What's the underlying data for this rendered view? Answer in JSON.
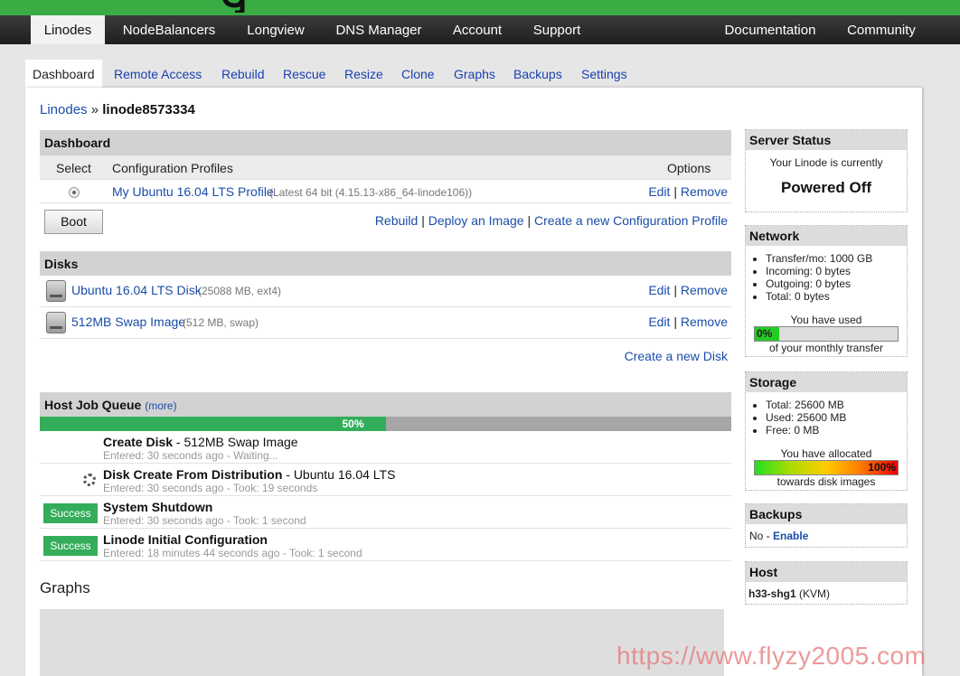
{
  "top_nav": {
    "items": [
      "Linodes",
      "NodeBalancers",
      "Longview",
      "DNS Manager",
      "Account",
      "Support"
    ],
    "right_items": [
      "Documentation",
      "Community"
    ],
    "active": "Linodes"
  },
  "sub_nav": {
    "items": [
      "Dashboard",
      "Remote Access",
      "Rebuild",
      "Rescue",
      "Resize",
      "Clone",
      "Graphs",
      "Backups",
      "Settings"
    ],
    "active": "Dashboard"
  },
  "breadcrumb": {
    "parent": "Linodes",
    "separator": "»",
    "current": "linode8573334"
  },
  "dashboard": {
    "heading": "Dashboard",
    "col_select": "Select",
    "col_profiles": "Configuration Profiles",
    "col_options": "Options",
    "profile": {
      "name": "My Ubuntu 16.04 LTS Profile",
      "detail": "(Latest 64 bit (4.15.13-x86_64-linode106))",
      "edit": "Edit",
      "sep": "|",
      "remove": "Remove"
    },
    "boot_label": "Boot",
    "actions": {
      "rebuild": "Rebuild",
      "deploy": "Deploy an Image",
      "create_profile": "Create a new Configuration Profile",
      "sep": "|"
    }
  },
  "disks": {
    "heading": "Disks",
    "items": [
      {
        "name": "Ubuntu 16.04 LTS Disk",
        "detail": "(25088 MB, ext4)",
        "edit": "Edit",
        "remove": "Remove"
      },
      {
        "name": "512MB Swap Image",
        "detail": "(512 MB, swap)",
        "edit": "Edit",
        "remove": "Remove"
      }
    ],
    "sep": "|",
    "create_label": "Create a new Disk"
  },
  "job_queue": {
    "heading": "Host Job Queue",
    "more": "(more)",
    "progress_percent": 50,
    "progress_label": "50%",
    "jobs": [
      {
        "status": "",
        "title": "Create Disk",
        "detail": " - 512MB Swap Image",
        "sub": "Entered: 30 seconds ago - Waiting..."
      },
      {
        "status": "spinner",
        "title": "Disk Create From Distribution",
        "detail": " - Ubuntu 16.04 LTS",
        "sub": "Entered: 30 seconds ago - Took: 19 seconds"
      },
      {
        "status": "Success",
        "title": "System Shutdown",
        "detail": "",
        "sub": "Entered: 30 seconds ago - Took: 1 second"
      },
      {
        "status": "Success",
        "title": "Linode Initial Configuration",
        "detail": "",
        "sub": "Entered: 18 minutes 44 seconds ago - Took: 1 second"
      }
    ]
  },
  "graphs": {
    "heading": "Graphs"
  },
  "sidebar": {
    "server_status": {
      "heading": "Server Status",
      "line": "Your Linode is currently",
      "state": "Powered Off"
    },
    "network": {
      "heading": "Network",
      "items": [
        "Transfer/mo: 1000 GB",
        "Incoming: 0 bytes",
        "Outgoing: 0 bytes",
        "Total: 0 bytes"
      ],
      "used_label": "You have used",
      "percent": 0,
      "percent_label": "0%",
      "after_label": "of your monthly transfer"
    },
    "storage": {
      "heading": "Storage",
      "items": [
        "Total: 25600 MB",
        "Used: 25600 MB",
        "Free: 0 MB"
      ],
      "allocated_label": "You have allocated",
      "percent": 100,
      "percent_label": "100%",
      "after_label": "towards disk images"
    },
    "backups": {
      "heading": "Backups",
      "status": "No",
      "sep": " - ",
      "enable": "Enable"
    },
    "host": {
      "heading": "Host",
      "name": "h33-shg1",
      "type": "(KVM)"
    }
  },
  "watermark": "https://www.flyzy2005.com",
  "colors": {
    "green": "#3aac44",
    "link": "#1a4da8",
    "success": "#34ad5a"
  }
}
